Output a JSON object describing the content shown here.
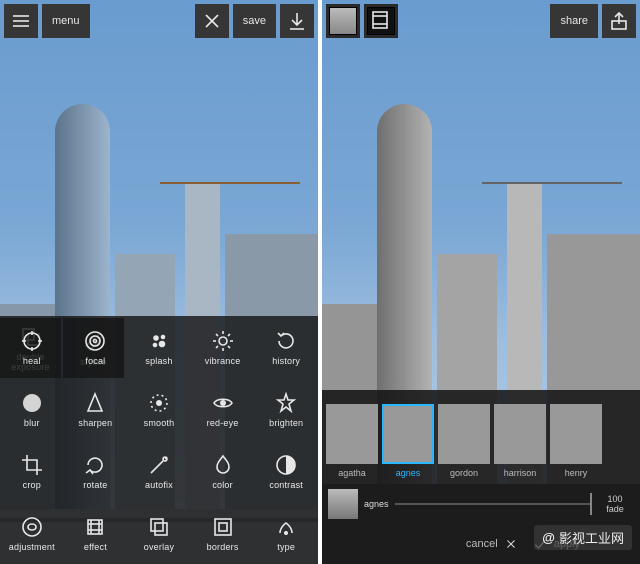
{
  "left": {
    "header": {
      "menu": "menu",
      "save": "save"
    },
    "topTools": [
      {
        "key": "double-exposure",
        "label": "double exposure"
      },
      {
        "key": "stylize",
        "label": "stylize"
      }
    ],
    "tools": [
      {
        "key": "heal",
        "label": "heal"
      },
      {
        "key": "focal",
        "label": "focal"
      },
      {
        "key": "splash",
        "label": "splash"
      },
      {
        "key": "vibrance",
        "label": "vibrance"
      },
      {
        "key": "history",
        "label": "history"
      },
      {
        "key": "blur",
        "label": "blur"
      },
      {
        "key": "sharpen",
        "label": "sharpen"
      },
      {
        "key": "smooth",
        "label": "smooth"
      },
      {
        "key": "red-eye",
        "label": "red-eye"
      },
      {
        "key": "brighten",
        "label": "brighten"
      },
      {
        "key": "crop",
        "label": "crop"
      },
      {
        "key": "rotate",
        "label": "rotate"
      },
      {
        "key": "autofix",
        "label": "autofix"
      },
      {
        "key": "color",
        "label": "color"
      },
      {
        "key": "contrast",
        "label": "contrast"
      },
      {
        "key": "adjustment",
        "label": "adjustment"
      },
      {
        "key": "effect",
        "label": "effect"
      },
      {
        "key": "overlay",
        "label": "overlay"
      },
      {
        "key": "borders",
        "label": "borders"
      },
      {
        "key": "type",
        "label": "type"
      }
    ]
  },
  "right": {
    "header": {
      "share": "share"
    },
    "filters": [
      {
        "key": "agatha",
        "label": "agatha",
        "selected": false
      },
      {
        "key": "agnes",
        "label": "agnes",
        "selected": true
      },
      {
        "key": "gordon",
        "label": "gordon",
        "selected": false
      },
      {
        "key": "harrison",
        "label": "harrison",
        "selected": false
      },
      {
        "key": "henry",
        "label": "henry",
        "selected": false
      }
    ],
    "fade": {
      "value": "100",
      "label": "fade",
      "sliderName": "agnes"
    },
    "bottom": {
      "cancel": "cancel",
      "apply": "apply"
    }
  },
  "watermark": {
    "prefix": "@",
    "text": "影视工业网"
  }
}
